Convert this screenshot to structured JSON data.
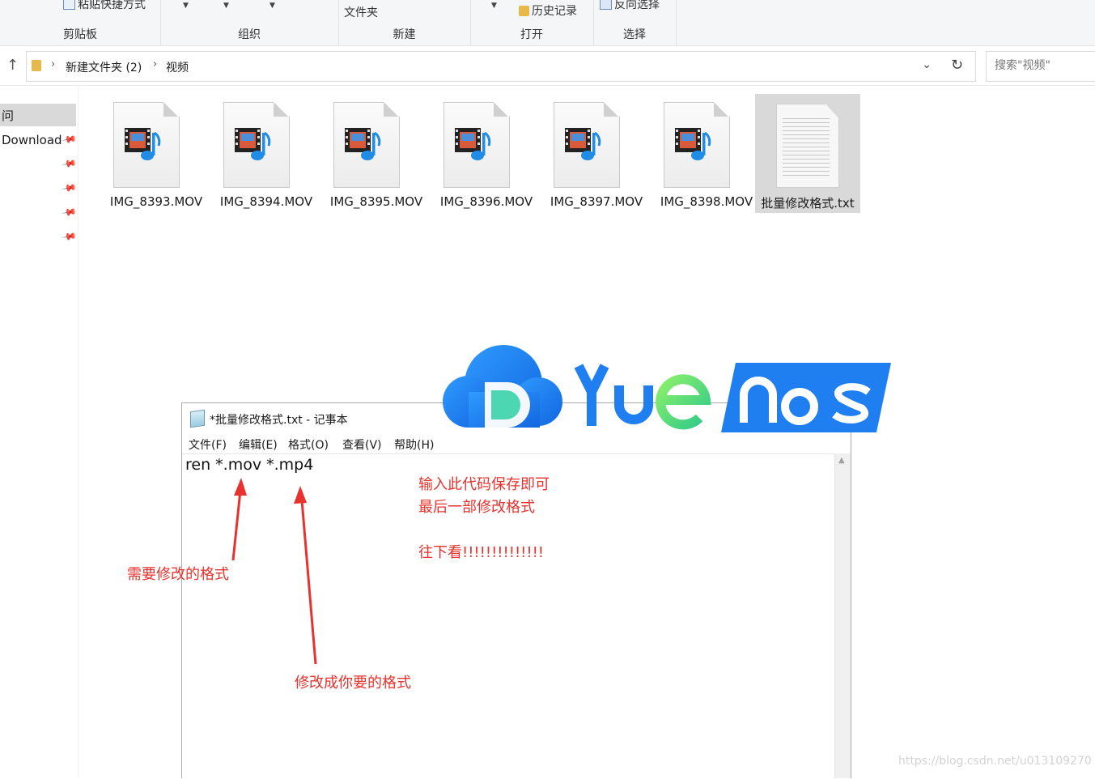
{
  "ribbon": {
    "paste_shortcut": "粘贴快捷方式",
    "folder_label": "文件夹",
    "history": "历史记录",
    "invert_selection": "反向选择",
    "groups": [
      "剪贴板",
      "组织",
      "新建",
      "打开",
      "选择"
    ]
  },
  "address": {
    "crumbs": [
      "新建文件夹 (2)",
      "视频"
    ],
    "search_placeholder": "搜索\"视频\""
  },
  "nav": {
    "quick_access_fragment": "问",
    "download": "Download"
  },
  "files": [
    {
      "name": "IMG_8393.MOV",
      "type": "mov"
    },
    {
      "name": "IMG_8394.MOV",
      "type": "mov"
    },
    {
      "name": "IMG_8395.MOV",
      "type": "mov"
    },
    {
      "name": "IMG_8396.MOV",
      "type": "mov"
    },
    {
      "name": "IMG_8397.MOV",
      "type": "mov"
    },
    {
      "name": "IMG_8398.MOV",
      "type": "mov"
    },
    {
      "name": "批量修改格式.txt",
      "type": "txt",
      "selected": true
    }
  ],
  "logo": {
    "text": "YuEnos"
  },
  "notepad": {
    "title": "*批量修改格式.txt - 记事本",
    "menu": [
      "文件(F)",
      "编辑(E)",
      "格式(O)",
      "查看(V)",
      "帮助(H)"
    ],
    "content": "ren *.mov *.mp4"
  },
  "annotations": {
    "note1_line1": "输入此代码保存即可",
    "note1_line2": "最后一部修改格式",
    "note1_line3": "往下看!!!!!!!!!!!!!!",
    "format_to_change": "需要修改的格式",
    "change_to": "修改成你要的格式"
  },
  "watermark": "https://blog.csdn.net/u013109270",
  "colors": {
    "annotation": "#e8322d",
    "selection": "#d9d9d9",
    "logo_blue": "#1f7ff0",
    "logo_green": "#5bd84a"
  }
}
